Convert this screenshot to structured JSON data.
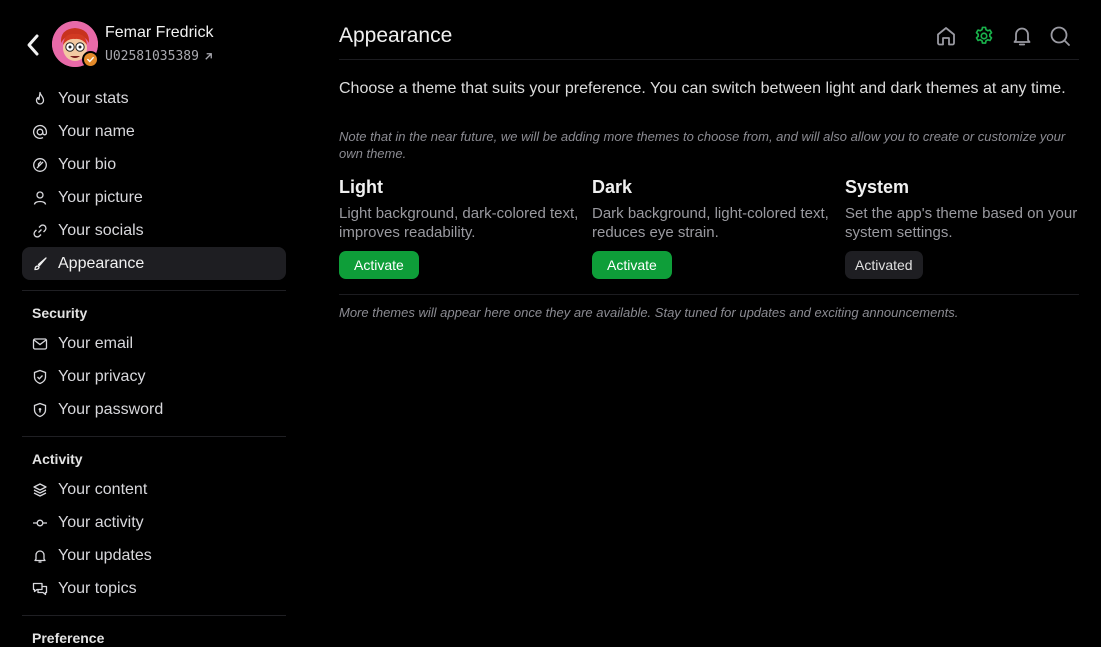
{
  "profile": {
    "name": "Femar Fredrick",
    "id": "U02581035389"
  },
  "nav": {
    "main": [
      {
        "label": "Your stats",
        "icon": "flame-icon"
      },
      {
        "label": "Your name",
        "icon": "at-icon"
      },
      {
        "label": "Your bio",
        "icon": "feather-icon"
      },
      {
        "label": "Your picture",
        "icon": "user-icon"
      },
      {
        "label": "Your socials",
        "icon": "link-icon"
      },
      {
        "label": "Appearance",
        "icon": "brush-icon",
        "active": true
      }
    ],
    "security_title": "Security",
    "security": [
      {
        "label": "Your email",
        "icon": "mail-icon"
      },
      {
        "label": "Your privacy",
        "icon": "shield-check-icon"
      },
      {
        "label": "Your password",
        "icon": "shield-lock-icon"
      }
    ],
    "activity_title": "Activity",
    "activity": [
      {
        "label": "Your content",
        "icon": "layers-icon"
      },
      {
        "label": "Your activity",
        "icon": "commit-icon"
      },
      {
        "label": "Your updates",
        "icon": "bell-icon"
      },
      {
        "label": "Your topics",
        "icon": "messages-icon"
      }
    ],
    "preference_title": "Preference"
  },
  "header": {
    "title": "Appearance",
    "icons": [
      "home-icon",
      "gear-icon",
      "bell-icon",
      "search-icon"
    ],
    "active_icon_color": "#19b24b"
  },
  "content": {
    "intro": "Choose a theme that suits your preference. You can switch between light and dark themes at any time.",
    "note": "Note that in the near future, we will be adding more themes to choose from, and will also allow you to create or customize your own theme.",
    "themes": [
      {
        "name": "Light",
        "desc": "Light background, dark-colored text, improves readability.",
        "button": "Activate",
        "activated": false
      },
      {
        "name": "Dark",
        "desc": "Dark background, light-colored text, reduces eye strain.",
        "button": "Activate",
        "activated": false
      },
      {
        "name": "System",
        "desc": "Set the app's theme based on your system settings.",
        "button": "Activated",
        "activated": true
      }
    ],
    "footer": "More themes will appear here once they are available. Stay tuned for updates and exciting announcements."
  },
  "colors": {
    "accent": "#0e9e39",
    "background": "#000000",
    "active_nav_bg": "#1e1e22"
  }
}
